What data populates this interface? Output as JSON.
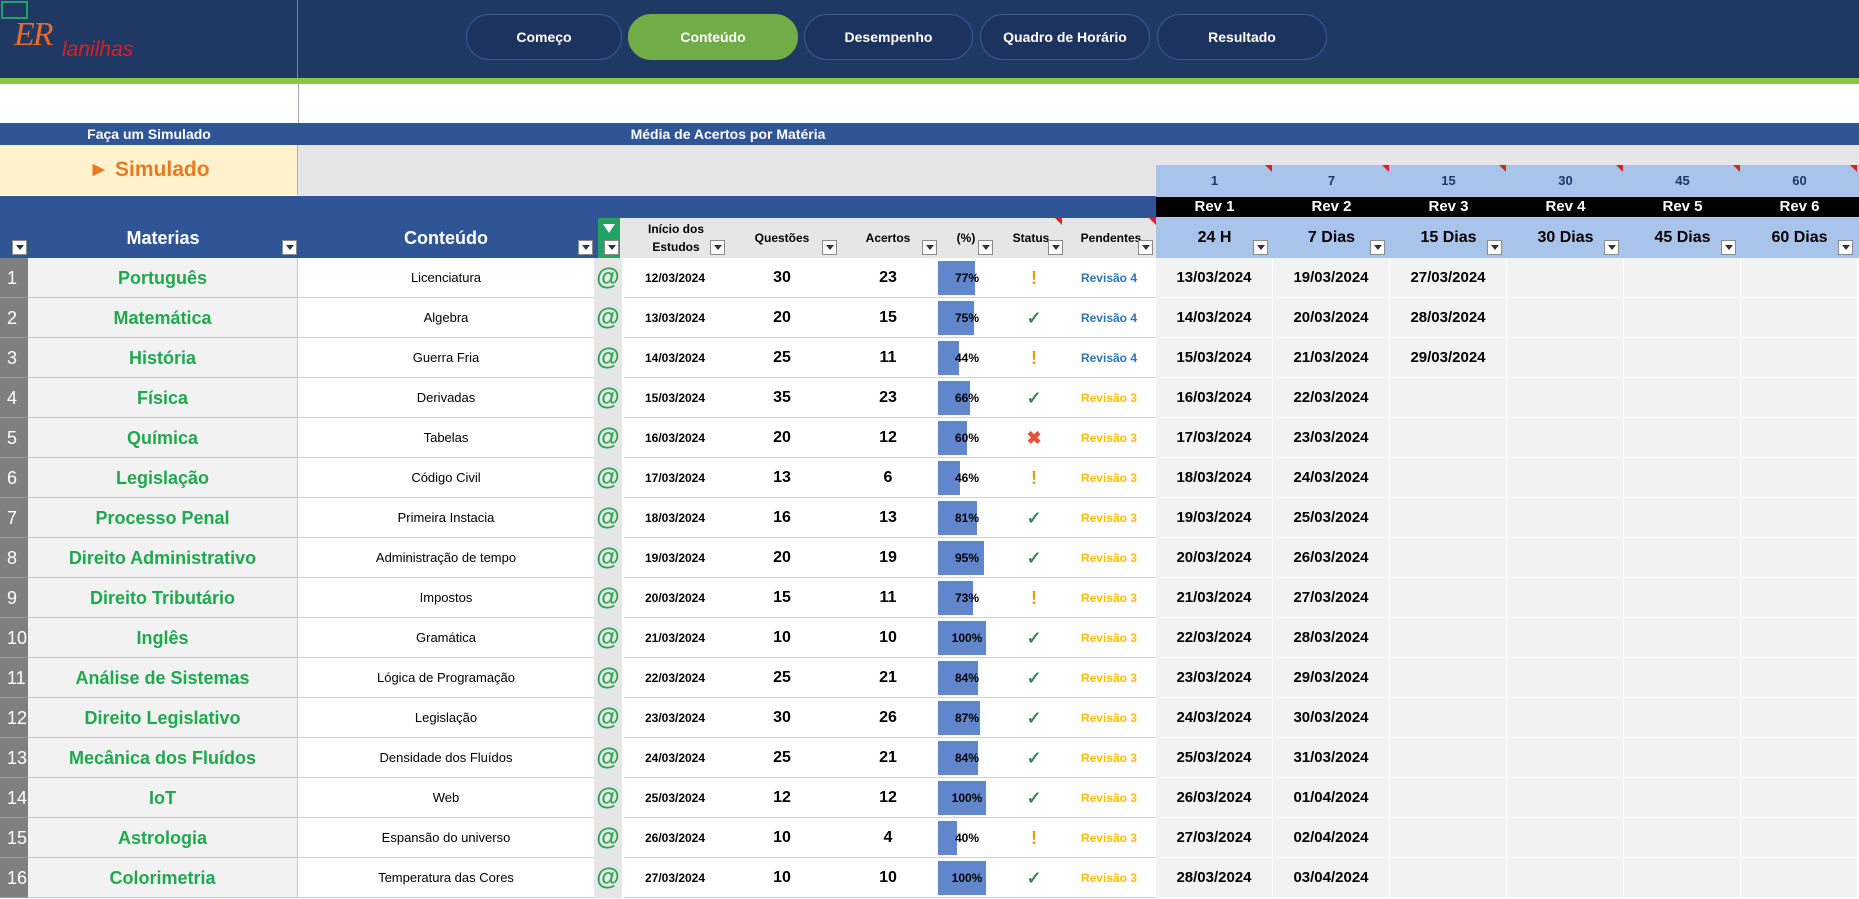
{
  "logo": {
    "er": "ER",
    "rest": "lanilhas"
  },
  "nav": [
    {
      "label": "Começo",
      "active": false
    },
    {
      "label": "Conteúdo",
      "active": true
    },
    {
      "label": "Desempenho",
      "active": false
    },
    {
      "label": "Quadro de Horário",
      "active": false
    },
    {
      "label": "Resultado",
      "active": false
    }
  ],
  "banner": {
    "left": "Faça um Simulado",
    "right": "Média de Acertos por Matéria"
  },
  "simulado": {
    "label": "► Simulado"
  },
  "columns": {
    "materias": "Materias",
    "conteudo": "Conteúdo",
    "inicio1": "Início dos",
    "inicio2": "Estudos",
    "questoes": "Questões",
    "acertos": "Acertos",
    "pct": "(%)",
    "status": "Status",
    "pendentes": "Pendentes"
  },
  "revisions": [
    {
      "num": "1",
      "name": "Rev 1",
      "days": "24 H"
    },
    {
      "num": "7",
      "name": "Rev 2",
      "days": "7 Dias"
    },
    {
      "num": "15",
      "name": "Rev 3",
      "days": "15 Dias"
    },
    {
      "num": "30",
      "name": "Rev 4",
      "days": "30 Dias"
    },
    {
      "num": "45",
      "name": "Rev 5",
      "days": "45 Dias"
    },
    {
      "num": "60",
      "name": "Rev 6",
      "days": "60 Dias"
    }
  ],
  "colors": {
    "navy": "#203864",
    "header_blue": "#2f5597",
    "accent_green": "#70ad47",
    "subject_green": "#1fa84e",
    "bar_blue": "#4472c4",
    "rev4_blue": "#2e75b6",
    "rev3_yellow": "#ffc000",
    "check_green": "#3c8a5a",
    "warn_orange": "#e6a117",
    "x_red": "#e5533d"
  },
  "rows": [
    {
      "n": "1",
      "materia": "Português",
      "conteudo": "Licenciatura",
      "at": "@",
      "inicio": "12/03/2024",
      "questoes": "30",
      "acertos": "23",
      "pct": "77%",
      "pct_value": 77,
      "status": "warn",
      "pendente": "Revisão 4",
      "revs": [
        "13/03/2024",
        "19/03/2024",
        "27/03/2024",
        "",
        "",
        ""
      ]
    },
    {
      "n": "2",
      "materia": "Matemática",
      "conteudo": "Algebra",
      "at": "@",
      "inicio": "13/03/2024",
      "questoes": "20",
      "acertos": "15",
      "pct": "75%",
      "pct_value": 75,
      "status": "check",
      "pendente": "Revisão 4",
      "revs": [
        "14/03/2024",
        "20/03/2024",
        "28/03/2024",
        "",
        "",
        ""
      ]
    },
    {
      "n": "3",
      "materia": "História",
      "conteudo": "Guerra Fria",
      "at": "@",
      "inicio": "14/03/2024",
      "questoes": "25",
      "acertos": "11",
      "pct": "44%",
      "pct_value": 44,
      "status": "warn",
      "pendente": "Revisão 4",
      "revs": [
        "15/03/2024",
        "21/03/2024",
        "29/03/2024",
        "",
        "",
        ""
      ]
    },
    {
      "n": "4",
      "materia": "Física",
      "conteudo": "Derivadas",
      "at": "@",
      "inicio": "15/03/2024",
      "questoes": "35",
      "acertos": "23",
      "pct": "66%",
      "pct_value": 66,
      "status": "check",
      "pendente": "Revisão 3",
      "revs": [
        "16/03/2024",
        "22/03/2024",
        "",
        "",
        "",
        ""
      ]
    },
    {
      "n": "5",
      "materia": "Química",
      "conteudo": "Tabelas",
      "at": "@",
      "inicio": "16/03/2024",
      "questoes": "20",
      "acertos": "12",
      "pct": "60%",
      "pct_value": 60,
      "status": "x",
      "pendente": "Revisão 3",
      "revs": [
        "17/03/2024",
        "23/03/2024",
        "",
        "",
        "",
        ""
      ]
    },
    {
      "n": "6",
      "materia": "Legislação",
      "conteudo": "Código Civil",
      "at": "@",
      "inicio": "17/03/2024",
      "questoes": "13",
      "acertos": "6",
      "pct": "46%",
      "pct_value": 46,
      "status": "warn",
      "pendente": "Revisão 3",
      "revs": [
        "18/03/2024",
        "24/03/2024",
        "",
        "",
        "",
        ""
      ]
    },
    {
      "n": "7",
      "materia": "Processo Penal",
      "conteudo": "Primeira Instacia",
      "at": "@",
      "inicio": "18/03/2024",
      "questoes": "16",
      "acertos": "13",
      "pct": "81%",
      "pct_value": 81,
      "status": "check",
      "pendente": "Revisão 3",
      "revs": [
        "19/03/2024",
        "25/03/2024",
        "",
        "",
        "",
        ""
      ]
    },
    {
      "n": "8",
      "materia": "Direito Administrativo",
      "conteudo": "Administração de tempo",
      "at": "@",
      "inicio": "19/03/2024",
      "questoes": "20",
      "acertos": "19",
      "pct": "95%",
      "pct_value": 95,
      "status": "check",
      "pendente": "Revisão 3",
      "revs": [
        "20/03/2024",
        "26/03/2024",
        "",
        "",
        "",
        ""
      ]
    },
    {
      "n": "9",
      "materia": "Direito Tributário",
      "conteudo": "Impostos",
      "at": "@",
      "inicio": "20/03/2024",
      "questoes": "15",
      "acertos": "11",
      "pct": "73%",
      "pct_value": 73,
      "status": "warn",
      "pendente": "Revisão 3",
      "revs": [
        "21/03/2024",
        "27/03/2024",
        "",
        "",
        "",
        ""
      ]
    },
    {
      "n": "10",
      "materia": "Inglês",
      "conteudo": "Gramática",
      "at": "@",
      "inicio": "21/03/2024",
      "questoes": "10",
      "acertos": "10",
      "pct": "100%",
      "pct_value": 100,
      "status": "check",
      "pendente": "Revisão 3",
      "revs": [
        "22/03/2024",
        "28/03/2024",
        "",
        "",
        "",
        ""
      ]
    },
    {
      "n": "11",
      "materia": "Análise de Sistemas",
      "conteudo": "Lógica de Programação",
      "at": "@",
      "inicio": "22/03/2024",
      "questoes": "25",
      "acertos": "21",
      "pct": "84%",
      "pct_value": 84,
      "status": "check",
      "pendente": "Revisão 3",
      "revs": [
        "23/03/2024",
        "29/03/2024",
        "",
        "",
        "",
        ""
      ]
    },
    {
      "n": "12",
      "materia": "Direito Legislativo",
      "conteudo": "Legislação",
      "at": "@",
      "inicio": "23/03/2024",
      "questoes": "30",
      "acertos": "26",
      "pct": "87%",
      "pct_value": 87,
      "status": "check",
      "pendente": "Revisão 3",
      "revs": [
        "24/03/2024",
        "30/03/2024",
        "",
        "",
        "",
        ""
      ]
    },
    {
      "n": "13",
      "materia": "Mecânica dos Fluídos",
      "conteudo": "Densidade dos Fluídos",
      "at": "@",
      "inicio": "24/03/2024",
      "questoes": "25",
      "acertos": "21",
      "pct": "84%",
      "pct_value": 84,
      "status": "check",
      "pendente": "Revisão 3",
      "revs": [
        "25/03/2024",
        "31/03/2024",
        "",
        "",
        "",
        ""
      ]
    },
    {
      "n": "14",
      "materia": "IoT",
      "conteudo": "Web",
      "at": "@",
      "inicio": "25/03/2024",
      "questoes": "12",
      "acertos": "12",
      "pct": "100%",
      "pct_value": 100,
      "status": "check",
      "pendente": "Revisão 3",
      "revs": [
        "26/03/2024",
        "01/04/2024",
        "",
        "",
        "",
        ""
      ]
    },
    {
      "n": "15",
      "materia": "Astrologia",
      "conteudo": "Espansão do universo",
      "at": "@",
      "inicio": "26/03/2024",
      "questoes": "10",
      "acertos": "4",
      "pct": "40%",
      "pct_value": 40,
      "status": "warn",
      "pendente": "Revisão 3",
      "revs": [
        "27/03/2024",
        "02/04/2024",
        "",
        "",
        "",
        ""
      ]
    },
    {
      "n": "16",
      "materia": "Colorimetria",
      "conteudo": "Temperatura das Cores",
      "at": "@",
      "inicio": "27/03/2024",
      "questoes": "10",
      "acertos": "10",
      "pct": "100%",
      "pct_value": 100,
      "status": "check",
      "pendente": "Revisão 3",
      "revs": [
        "28/03/2024",
        "03/04/2024",
        "",
        "",
        "",
        ""
      ]
    }
  ]
}
